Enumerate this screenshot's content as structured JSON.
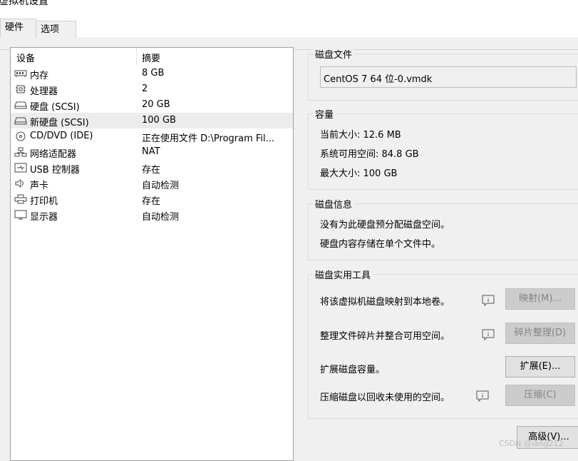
{
  "window": {
    "title": "虚拟机设置"
  },
  "tabs": [
    {
      "label": "硬件"
    },
    {
      "label": "选项"
    }
  ],
  "device_list": {
    "headers": {
      "device": "设备",
      "summary": "摘要"
    },
    "rows": [
      {
        "icon": "memory-icon",
        "name": "内存",
        "summary": "8 GB"
      },
      {
        "icon": "processor-icon",
        "name": "处理器",
        "summary": "2"
      },
      {
        "icon": "hard-disk-icon",
        "name": "硬盘 (SCSI)",
        "summary": "20 GB"
      },
      {
        "icon": "hard-disk-icon",
        "name": "新硬盘 (SCSI)",
        "summary": "100 GB",
        "selected": true
      },
      {
        "icon": "cd-dvd-icon",
        "name": "CD/DVD (IDE)",
        "summary": "正在使用文件 D:\\Program Fil..."
      },
      {
        "icon": "network-adapter-icon",
        "name": "网络适配器",
        "summary": "NAT"
      },
      {
        "icon": "usb-icon",
        "name": "USB 控制器",
        "summary": "存在"
      },
      {
        "icon": "sound-icon",
        "name": "声卡",
        "summary": "自动检测"
      },
      {
        "icon": "printer-icon",
        "name": "打印机",
        "summary": "存在"
      },
      {
        "icon": "display-icon",
        "name": "显示器",
        "summary": "自动检测"
      }
    ]
  },
  "disk_file": {
    "title": "磁盘文件",
    "value": "CentOS 7 64 位-0.vmdk"
  },
  "capacity": {
    "title": "容量",
    "current_size": "当前大小: 12.6 MB",
    "available": "系统可用空间: 84.8 GB",
    "max_size": "最大大小: 100 GB"
  },
  "disk_info": {
    "title": "磁盘信息",
    "line1": "没有为此硬盘预分配磁盘空间。",
    "line2": "硬盘内容存储在单个文件中。"
  },
  "utilities": {
    "title": "磁盘实用工具",
    "map_text": "将该虚拟机磁盘映射到本地卷。",
    "map_button": "映射(M)...",
    "defrag_text": "整理文件碎片并整合可用空间。",
    "defrag_button": "碎片整理(D)",
    "expand_text": "扩展磁盘容量。",
    "expand_button": "扩展(E)...",
    "compact_text": "压缩磁盘以回收未使用的空间。",
    "compact_button": "压缩(C)"
  },
  "advanced_button": "高级(V)...",
  "watermark": "CSDN @lang212"
}
